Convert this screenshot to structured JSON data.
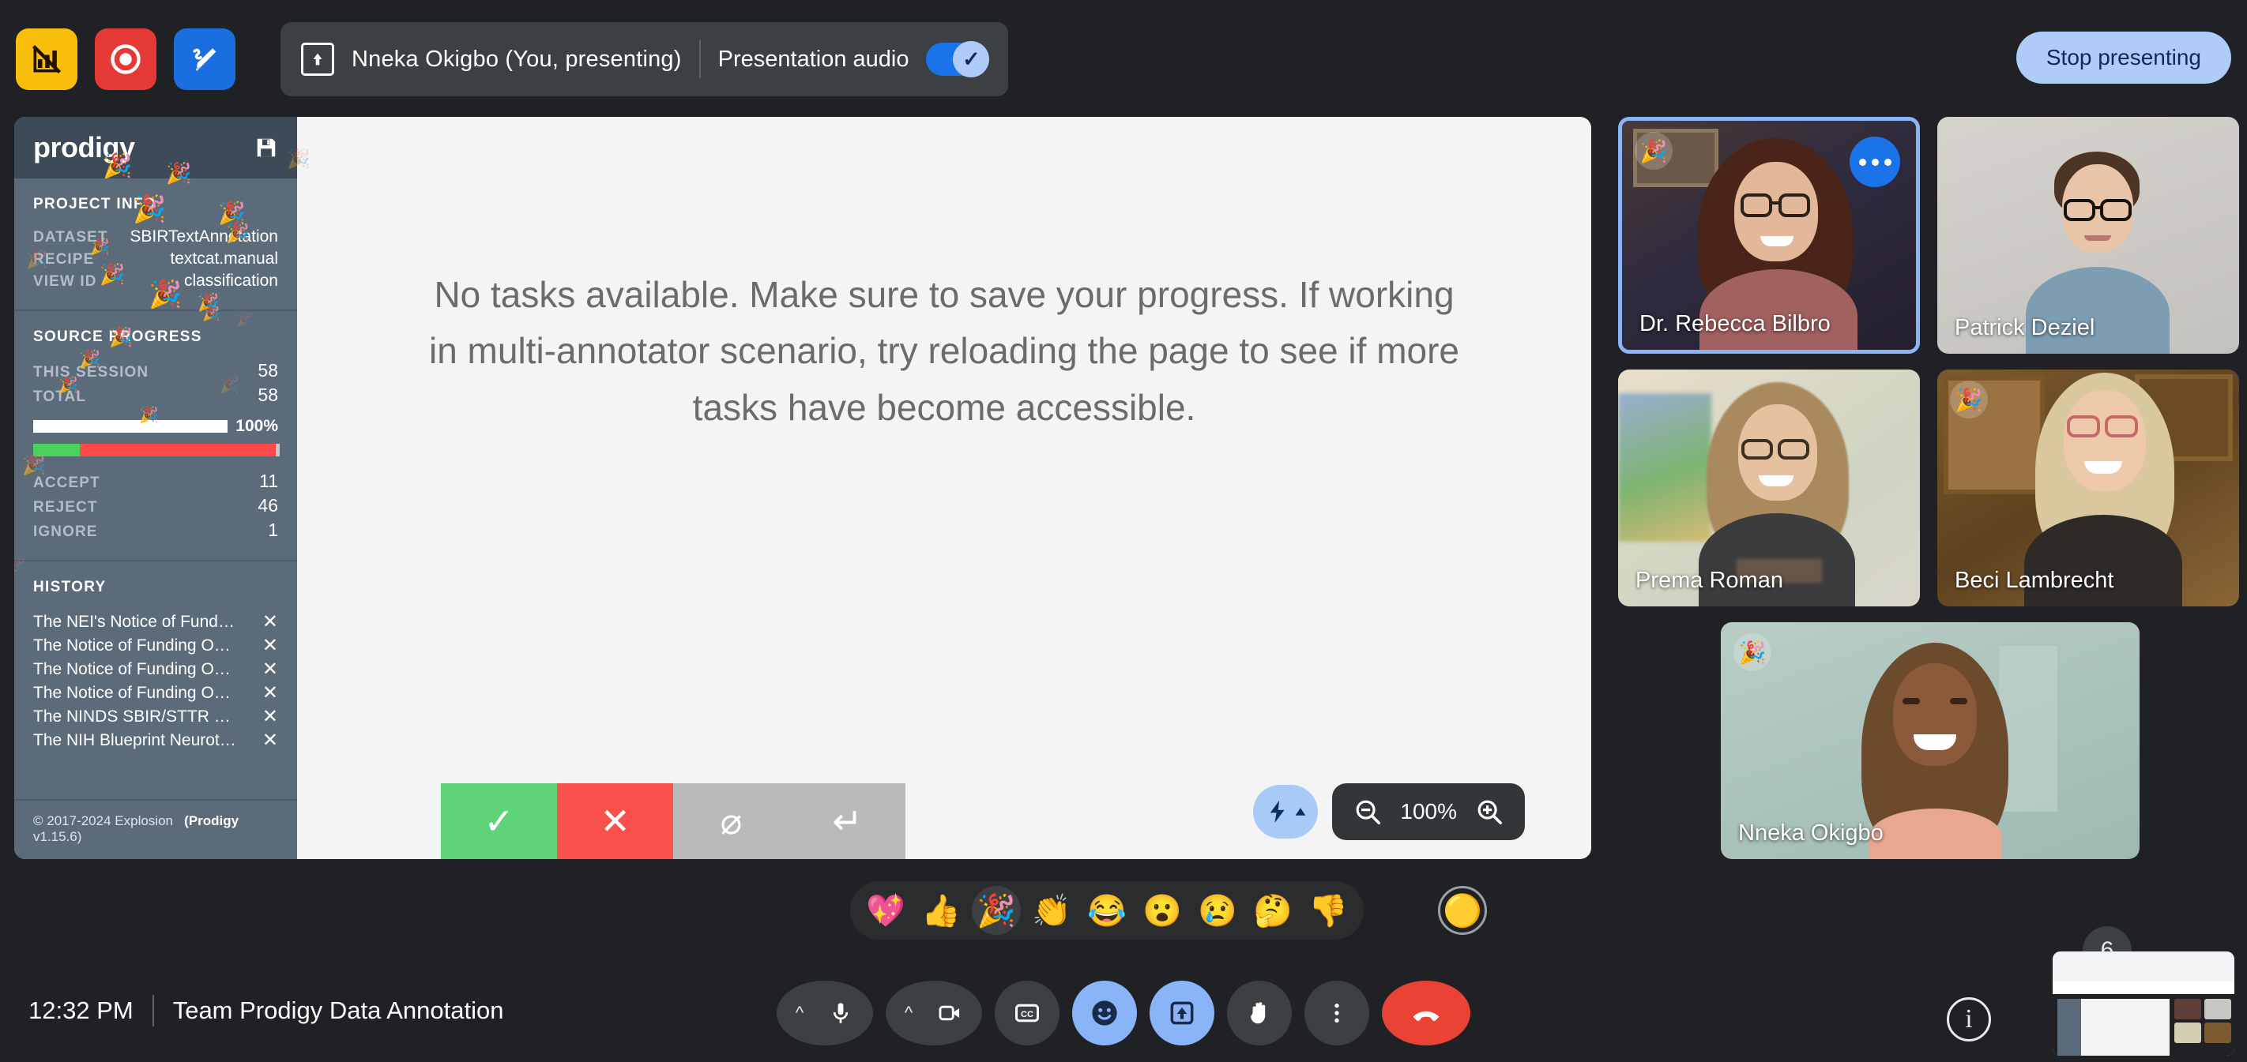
{
  "topbar": {
    "extensions": [
      {
        "name": "prodigy-extension",
        "icon": "no-chart-icon",
        "color": "#f9bd0b"
      },
      {
        "name": "record-extension",
        "icon": "record-icon",
        "color": "#e53935"
      },
      {
        "name": "scribe-extension",
        "icon": "scribe-pen-icon",
        "color": "#1a6fe0"
      }
    ],
    "presenting_label": "Nneka Okigbo (You, presenting)",
    "presentation_audio_label": "Presentation audio",
    "presentation_audio_on": true,
    "stop_presenting_label": "Stop presenting",
    "accent_blue": "#1a73e8",
    "button_blue": "#aecbfa"
  },
  "prodigy": {
    "logo": "prodigy",
    "save_icon": "floppy-disk-icon",
    "project_info": {
      "title": "PROJECT INFO",
      "rows": [
        {
          "key": "DATASET",
          "value": "SBIRTextAnnotation"
        },
        {
          "key": "RECIPE",
          "value": "textcat.manual"
        },
        {
          "key": "VIEW ID",
          "value": "classification"
        }
      ]
    },
    "source_progress": {
      "title": "SOURCE PROGRESS",
      "rows": [
        {
          "key": "THIS SESSION",
          "value": "58"
        },
        {
          "key": "TOTAL",
          "value": "58"
        }
      ],
      "percent_label": "100%",
      "percent": 100,
      "stats": [
        {
          "key": "ACCEPT",
          "value": "11",
          "color": "#4ad15e"
        },
        {
          "key": "REJECT",
          "value": "46",
          "color": "#fc4b48"
        },
        {
          "key": "IGNORE",
          "value": "1",
          "color": "#c9c9c9"
        }
      ]
    },
    "history": {
      "title": "HISTORY",
      "items": [
        "The NEI's Notice of Funding O...",
        "The Notice of Funding Opport...",
        "The Notice of Funding Opport...",
        "The Notice of Funding Opport...",
        "The NINDS SBIR/STTR progra...",
        "The NIH Blueprint Neurothera..."
      ],
      "remove_icon": "close-icon"
    },
    "footer_copyright": "© 2017-2024 Explosion",
    "footer_product": "(Prodigy",
    "footer_version": " v1.15.6)"
  },
  "stage": {
    "empty_message": "No tasks available. Make sure to save your progress. If working in multi-annotator scenario, try reloading the page to see if more tasks have become accessible.",
    "actions": [
      {
        "name": "accept-button",
        "icon": "check-icon",
        "glyph": "✓",
        "color": "#5fd377"
      },
      {
        "name": "reject-button",
        "icon": "cross-icon",
        "glyph": "✕",
        "color": "#f9514c"
      },
      {
        "name": "ignore-button",
        "icon": "no-entry-icon",
        "glyph": "⌀",
        "color": "#b9b9b9"
      },
      {
        "name": "undo-button",
        "icon": "undo-arrow-icon",
        "glyph": "↵",
        "color": "#b9b9b9"
      }
    ],
    "zoom": {
      "level": "100%",
      "zoom_out_icon": "zoom-out-icon",
      "zoom_in_icon": "zoom-in-icon",
      "lightning_icon": "lightning-bolt-icon",
      "caret_icon": "caret-up-icon"
    }
  },
  "participants": [
    {
      "name": "Dr. Rebecca Bilbro",
      "tile": "tile-rebecca",
      "active_speaker": true,
      "reaction": "🎉",
      "menu_icon": "more-options-icon"
    },
    {
      "name": "Patrick Deziel",
      "tile": "tile-patrick",
      "active_speaker": false,
      "reaction": ""
    },
    {
      "name": "Prema Roman",
      "tile": "tile-prema",
      "active_speaker": false,
      "reaction": ""
    },
    {
      "name": "Beci Lambrecht",
      "tile": "tile-beci",
      "active_speaker": false,
      "reaction": "🎉"
    },
    {
      "name": "Nneka Okigbo",
      "tile": "tile-nneka",
      "active_speaker": false,
      "reaction": "🎉"
    }
  ],
  "reactions": {
    "items": [
      {
        "name": "sparkling-heart-reaction",
        "glyph": "💖"
      },
      {
        "name": "thumbs-up-reaction",
        "glyph": "👍"
      },
      {
        "name": "party-popper-reaction",
        "glyph": "🎉",
        "hovered": true
      },
      {
        "name": "clapping-hands-reaction",
        "glyph": "👏"
      },
      {
        "name": "joy-reaction",
        "glyph": "😂"
      },
      {
        "name": "open-mouth-reaction",
        "glyph": "😮"
      },
      {
        "name": "crying-reaction",
        "glyph": "😢"
      },
      {
        "name": "thinking-reaction",
        "glyph": "🤔"
      },
      {
        "name": "thumbs-down-reaction",
        "glyph": "👎"
      }
    ],
    "more_glyph": "🟡"
  },
  "bottombar": {
    "time": "12:32 PM",
    "meeting_name": "Team Prodigy Data Annotation",
    "controls": [
      {
        "name": "microphone-button",
        "icon": "microphone-icon",
        "has_chevron": true,
        "state": "default"
      },
      {
        "name": "camera-button",
        "icon": "video-camera-icon",
        "has_chevron": true,
        "state": "default"
      },
      {
        "name": "captions-button",
        "icon": "closed-captions-icon",
        "has_chevron": false,
        "state": "default"
      },
      {
        "name": "reactions-button",
        "icon": "smiley-face-icon",
        "has_chevron": false,
        "state": "active"
      },
      {
        "name": "present-now-button",
        "icon": "present-screen-icon",
        "has_chevron": false,
        "state": "active"
      },
      {
        "name": "raise-hand-button",
        "icon": "raised-hand-icon",
        "has_chevron": false,
        "state": "default"
      },
      {
        "name": "more-options-button",
        "icon": "vertical-dots-icon",
        "has_chevron": false,
        "state": "default"
      },
      {
        "name": "leave-call-button",
        "icon": "hang-up-icon",
        "has_chevron": false,
        "state": "hangup"
      }
    ],
    "info_icon": "info-icon",
    "participant_count": "6",
    "selfview_label": "self-view-thumbnail"
  }
}
